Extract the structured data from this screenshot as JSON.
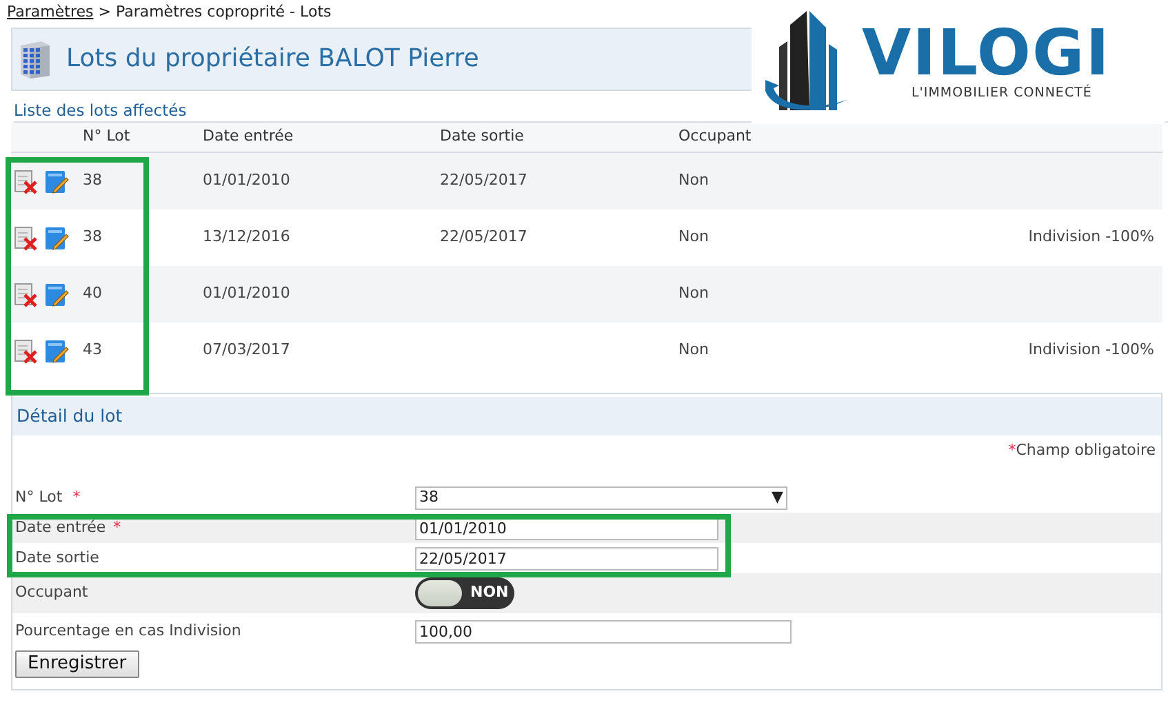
{
  "breadcrumb": {
    "link": "Paramètres",
    "separator": ">",
    "current": "Paramètres coproprité - Lots"
  },
  "title": "Lots du propriétaire BALOT Pierre",
  "logo": {
    "name": "VILOGI",
    "tagline": "L'IMMOBILIER CONNECTÉ"
  },
  "lots_list": {
    "caption": "Liste des lots affectés",
    "columns": [
      "N° Lot",
      "Date entrée",
      "Date sortie",
      "Occupant"
    ],
    "rows": [
      {
        "lot": "38",
        "date_entree": "01/01/2010",
        "date_sortie": "22/05/2017",
        "occupant": "Non"
      },
      {
        "lot": "38",
        "date_entree": "13/12/2016",
        "date_sortie": "22/05/2017",
        "occupant": "Non",
        "note": "Indivision -100%"
      },
      {
        "lot": "40",
        "date_entree": "01/01/2010",
        "occupant": "Non"
      },
      {
        "lot": "43",
        "date_entree": "07/03/2017",
        "occupant": "Non",
        "note": "Indivision -100%"
      }
    ]
  },
  "detail": {
    "title": "Détail du lot",
    "required_note": "Champ obligatoire",
    "required_mark": "*",
    "fields": [
      {
        "kind": "select",
        "label": "N° Lot",
        "required": true,
        "value": "38",
        "caret": "▼"
      },
      {
        "kind": "text",
        "label": "Date entrée",
        "required": true,
        "value": "01/01/2010"
      },
      {
        "kind": "text",
        "label": "Date sortie",
        "required": false,
        "value": "22/05/2017"
      },
      {
        "kind": "switch",
        "label": "Occupant",
        "on": false,
        "text": "NON"
      },
      {
        "kind": "text",
        "label": "Pourcentage en cas Indivision",
        "required": false,
        "value": "100,00"
      }
    ],
    "save_button": "Enregistrer"
  },
  "annotations": [
    {
      "kind": "frame"
    },
    {
      "kind": "frame"
    }
  ]
}
